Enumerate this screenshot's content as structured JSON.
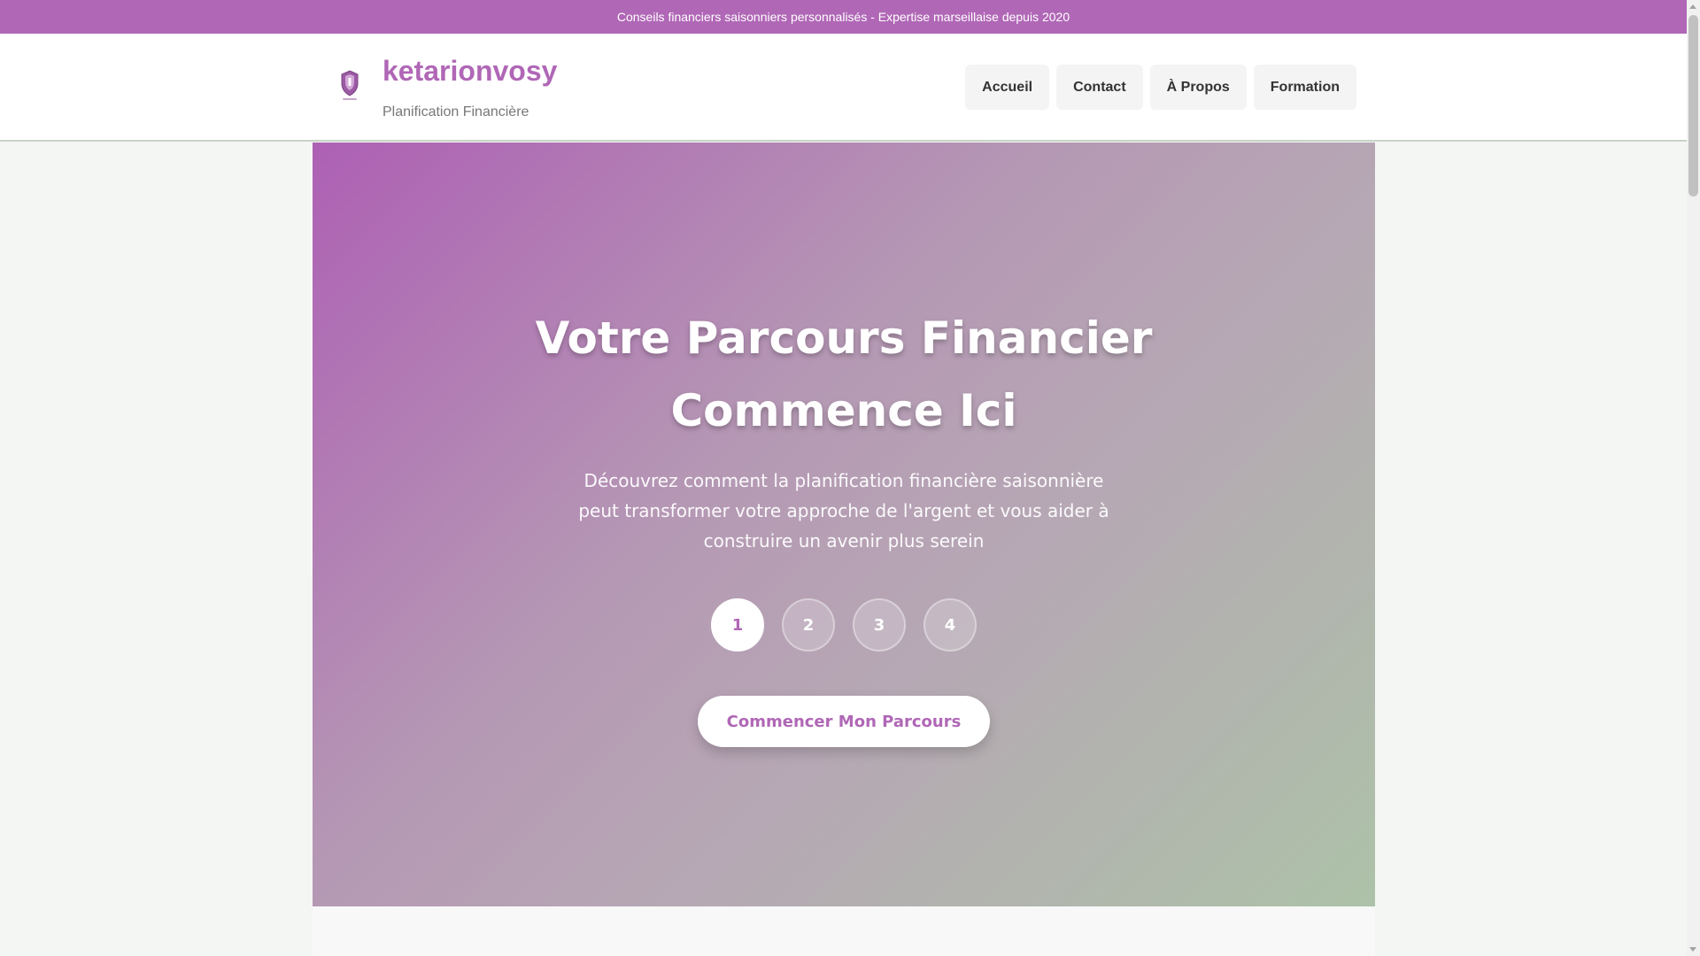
{
  "topbar": {
    "text": "Conseils financiers saisonniers personnalisés - Expertise marseillaise depuis 2020"
  },
  "header": {
    "brand": "ketarionvosy",
    "tagline": "Planification Financière",
    "logo_icon": "shield-logo-icon",
    "nav": [
      {
        "label": "Accueil"
      },
      {
        "label": "Contact"
      },
      {
        "label": "À Propos"
      },
      {
        "label": "Formation"
      }
    ]
  },
  "hero": {
    "title_line1": "Votre Parcours Financier",
    "title_line2": "Commence Ici",
    "description": "Découvrez comment la planification financière saisonnière peut transformer votre approche de l'argent et vous aider à construire un avenir plus serein",
    "steps": [
      "1",
      "2",
      "3",
      "4"
    ],
    "active_step": "1",
    "cta_label": "Commencer Mon Parcours"
  },
  "colors": {
    "brand": "#b067b6",
    "hero_gradient_start": "#ae60b4",
    "hero_gradient_end": "#adc2a8"
  }
}
